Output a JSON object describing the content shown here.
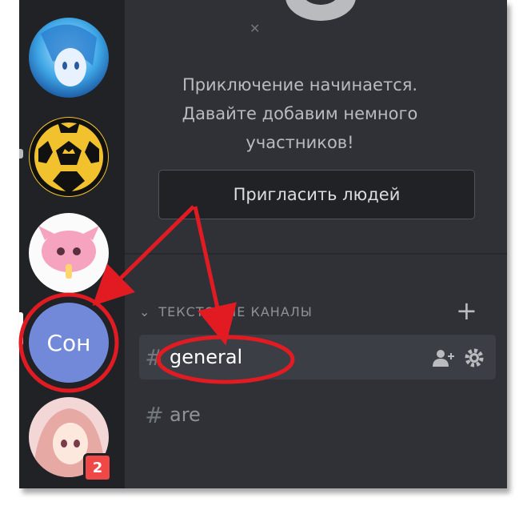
{
  "servers": [
    {
      "icon": "anime-avatar-blue",
      "name": ""
    },
    {
      "icon": "soccer-ball-crown",
      "name": ""
    },
    {
      "icon": "pink-creature-avatar",
      "name": ""
    },
    {
      "icon": "initials",
      "name": "Сон"
    },
    {
      "icon": "anime-avatar-pink",
      "badge": "2"
    }
  ],
  "welcome": {
    "line1": "Приключение начинается.",
    "line2": "Давайте добавим немного",
    "line3": "участников!"
  },
  "invite_button": "Пригласить людей",
  "category": {
    "label": "ТЕКСТОВЫЕ КАНАЛЫ"
  },
  "channels": [
    {
      "name": "general",
      "active": true
    },
    {
      "name": "are",
      "active": false
    }
  ],
  "colors": {
    "annotation": "#e21b23",
    "blurple": "#7289da",
    "badge": "#f04747"
  }
}
